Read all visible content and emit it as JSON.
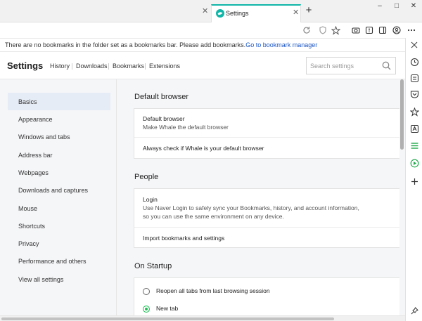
{
  "browser": {
    "active_tab_title": "Settings",
    "new_tab_label": "+",
    "window_controls": {
      "minimize": "–",
      "maximize": "□",
      "close": "✕"
    },
    "accent_color": "#10b6a8"
  },
  "bookmark_bar": {
    "message": "There are no bookmarks in the folder set as a bookmarks bar. Please add bookmarks.",
    "link": "Go to bookmark manager"
  },
  "header": {
    "title": "Settings",
    "nav": [
      "History",
      "Downloads",
      "Bookmarks",
      "Extensions"
    ],
    "search_placeholder": "Search settings"
  },
  "sidebar": {
    "items": [
      {
        "label": "Basics",
        "active": true
      },
      {
        "label": "Appearance"
      },
      {
        "label": "Windows and tabs"
      },
      {
        "label": "Address bar"
      },
      {
        "label": "Webpages"
      },
      {
        "label": "Downloads and captures"
      },
      {
        "label": "Mouse"
      },
      {
        "label": "Shortcuts"
      },
      {
        "label": "Privacy"
      },
      {
        "label": "Performance and others"
      },
      {
        "label": "View all settings"
      }
    ]
  },
  "sections": {
    "default_browser": {
      "title": "Default browser",
      "item_title": "Default browser",
      "item_desc": "Make Whale the default browser",
      "check_label": "Always check if Whale is your default browser"
    },
    "people": {
      "title": "People",
      "login_title": "Login",
      "login_desc_1": "Use Naver Login to safely sync your Bookmarks, history, and account information,",
      "login_desc_2": "so you can use the same environment on any device.",
      "import_label": "Import bookmarks and settings"
    },
    "startup": {
      "title": "On Startup",
      "options": [
        {
          "label": "Reopen all tabs from last browsing session",
          "checked": false
        },
        {
          "label": "New tab",
          "checked": true
        }
      ]
    }
  }
}
